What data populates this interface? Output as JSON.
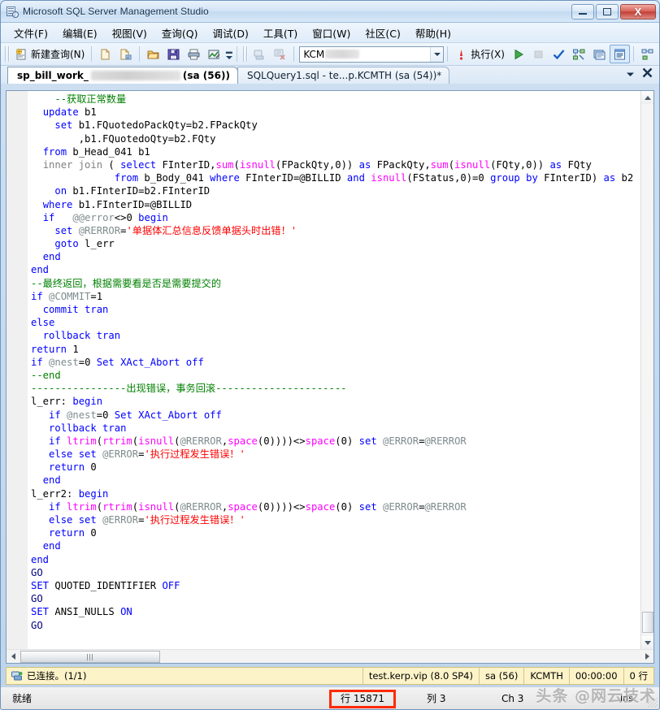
{
  "window": {
    "title": "Microsoft SQL Server Management Studio",
    "app_icon": "ssms-icon",
    "minimize_label": "",
    "maximize_label": "",
    "close_label": "X"
  },
  "menubar": {
    "items": [
      {
        "label": "文件(F)",
        "name": "menu-file"
      },
      {
        "label": "编辑(E)",
        "name": "menu-edit"
      },
      {
        "label": "视图(V)",
        "name": "menu-view"
      },
      {
        "label": "查询(Q)",
        "name": "menu-query"
      },
      {
        "label": "调试(D)",
        "name": "menu-debug"
      },
      {
        "label": "工具(T)",
        "name": "menu-tools"
      },
      {
        "label": "窗口(W)",
        "name": "menu-window"
      },
      {
        "label": "社区(C)",
        "name": "menu-community"
      },
      {
        "label": "帮助(H)",
        "name": "menu-help"
      }
    ]
  },
  "toolbar": {
    "new_query_label": "新建查询(N)",
    "execute_label": "执行(X)",
    "database_combo_value": "KCM",
    "database_combo_redacted": true,
    "icons": [
      "new-query-icon",
      "new-file-icon",
      "new-file-script-icon",
      "open-folder-icon",
      "save-icon",
      "print-icon",
      "analyze-icon",
      "server-icon",
      "server-stop-icon",
      "execute-run-icon",
      "stop-icon",
      "parse-check-icon",
      "display-plan-icon",
      "client-stats-icon",
      "results-grid-icon",
      "results-text-icon",
      "include-plan-icon",
      "results-file-icon"
    ]
  },
  "tabs": {
    "items": [
      {
        "name": "tab-sp-bill-work",
        "prefix": "sp_bill_work_",
        "redacted": true,
        "suffix": "(sa (56))",
        "active": true
      },
      {
        "name": "tab-sqlquery1",
        "prefix": "SQLQuery1.sql - te...p.KCMTH (sa (54))*",
        "redacted": false,
        "suffix": "",
        "active": false
      }
    ],
    "dropdown_icon": "chevron-down-icon",
    "close_icon": "close-icon"
  },
  "editor": {
    "lines": [
      [
        {
          "t": "    ",
          "c": "pl"
        },
        {
          "t": "--获取正常数量",
          "c": "cm"
        }
      ],
      [
        {
          "t": "  ",
          "c": "pl"
        },
        {
          "t": "update",
          "c": "kw"
        },
        {
          "t": " b1",
          "c": "pl"
        }
      ],
      [
        {
          "t": "    ",
          "c": "pl"
        },
        {
          "t": "set",
          "c": "kw"
        },
        {
          "t": " b1.FQuotedoPackQty=b2.FPackQty",
          "c": "pl"
        }
      ],
      [
        {
          "t": "        ,b1.FQuotedoQty=b2.FQty",
          "c": "pl"
        }
      ],
      [
        {
          "t": "  ",
          "c": "pl"
        },
        {
          "t": "from",
          "c": "kw"
        },
        {
          "t": " b_Head_041 b1",
          "c": "pl"
        }
      ],
      [
        {
          "t": "  ",
          "c": "pl"
        },
        {
          "t": "inner join",
          "c": "op"
        },
        {
          "t": " ( ",
          "c": "pl"
        },
        {
          "t": "select",
          "c": "kw"
        },
        {
          "t": " FInterID,",
          "c": "pl"
        },
        {
          "t": "sum",
          "c": "fn"
        },
        {
          "t": "(",
          "c": "pl"
        },
        {
          "t": "isnull",
          "c": "fn"
        },
        {
          "t": "(FPackQty,",
          "c": "pl"
        },
        {
          "t": "0",
          "c": "num"
        },
        {
          "t": ")) ",
          "c": "pl"
        },
        {
          "t": "as",
          "c": "kw"
        },
        {
          "t": " FPackQty,",
          "c": "pl"
        },
        {
          "t": "sum",
          "c": "fn"
        },
        {
          "t": "(",
          "c": "pl"
        },
        {
          "t": "isnull",
          "c": "fn"
        },
        {
          "t": "(FQty,",
          "c": "pl"
        },
        {
          "t": "0",
          "c": "num"
        },
        {
          "t": ")) ",
          "c": "pl"
        },
        {
          "t": "as",
          "c": "kw"
        },
        {
          "t": " FQty",
          "c": "pl"
        }
      ],
      [
        {
          "t": "              ",
          "c": "pl"
        },
        {
          "t": "from",
          "c": "kw"
        },
        {
          "t": " b_Body_041 ",
          "c": "pl"
        },
        {
          "t": "where",
          "c": "kw"
        },
        {
          "t": " FInterID=@BILLID ",
          "c": "pl"
        },
        {
          "t": "and",
          "c": "kw"
        },
        {
          "t": " ",
          "c": "pl"
        },
        {
          "t": "isnull",
          "c": "fn"
        },
        {
          "t": "(FStatus,",
          "c": "pl"
        },
        {
          "t": "0",
          "c": "num"
        },
        {
          "t": ")=",
          "c": "pl"
        },
        {
          "t": "0",
          "c": "num"
        },
        {
          "t": " ",
          "c": "pl"
        },
        {
          "t": "group by",
          "c": "kw"
        },
        {
          "t": " FInterID) ",
          "c": "pl"
        },
        {
          "t": "as",
          "c": "kw"
        },
        {
          "t": " b2",
          "c": "pl"
        }
      ],
      [
        {
          "t": "    ",
          "c": "pl"
        },
        {
          "t": "on",
          "c": "kw"
        },
        {
          "t": " b1.FInterID=b2.FInterID",
          "c": "pl"
        }
      ],
      [
        {
          "t": "  ",
          "c": "pl"
        },
        {
          "t": "where",
          "c": "kw"
        },
        {
          "t": " b1.FInterID=@BILLID",
          "c": "pl"
        }
      ],
      [
        {
          "t": "  ",
          "c": "pl"
        },
        {
          "t": "if",
          "c": "kw"
        },
        {
          "t": "   ",
          "c": "pl"
        },
        {
          "t": "@@error",
          "c": "var"
        },
        {
          "t": "<>",
          "c": "pl"
        },
        {
          "t": "0",
          "c": "num"
        },
        {
          "t": " ",
          "c": "pl"
        },
        {
          "t": "begin",
          "c": "kw"
        }
      ],
      [
        {
          "t": "    ",
          "c": "pl"
        },
        {
          "t": "set",
          "c": "kw"
        },
        {
          "t": " ",
          "c": "pl"
        },
        {
          "t": "@RERROR",
          "c": "var"
        },
        {
          "t": "=",
          "c": "pl"
        },
        {
          "t": "'单据体汇总信息反馈单据头时出错！'",
          "c": "st"
        }
      ],
      [
        {
          "t": "    ",
          "c": "pl"
        },
        {
          "t": "goto",
          "c": "kw"
        },
        {
          "t": " l_err",
          "c": "pl"
        }
      ],
      [
        {
          "t": "  ",
          "c": "pl"
        },
        {
          "t": "end",
          "c": "kw"
        }
      ],
      [
        {
          "t": "",
          "c": "pl"
        },
        {
          "t": "end",
          "c": "kw"
        }
      ],
      [
        {
          "t": "--最终返回，根据需要看是否是需要提交的",
          "c": "cm"
        }
      ],
      [
        {
          "t": "",
          "c": "pl"
        },
        {
          "t": "if",
          "c": "kw"
        },
        {
          "t": " ",
          "c": "pl"
        },
        {
          "t": "@COMMIT",
          "c": "var"
        },
        {
          "t": "=",
          "c": "pl"
        },
        {
          "t": "1",
          "c": "num"
        }
      ],
      [
        {
          "t": "  ",
          "c": "pl"
        },
        {
          "t": "commit tran",
          "c": "kw"
        }
      ],
      [
        {
          "t": "",
          "c": "pl"
        },
        {
          "t": "else",
          "c": "kw"
        }
      ],
      [
        {
          "t": "  ",
          "c": "pl"
        },
        {
          "t": "rollback tran",
          "c": "kw"
        }
      ],
      [
        {
          "t": "",
          "c": "pl"
        },
        {
          "t": "return",
          "c": "kw"
        },
        {
          "t": " ",
          "c": "pl"
        },
        {
          "t": "1",
          "c": "num"
        }
      ],
      [
        {
          "t": "",
          "c": "pl"
        },
        {
          "t": "if",
          "c": "kw"
        },
        {
          "t": " ",
          "c": "pl"
        },
        {
          "t": "@nest",
          "c": "var"
        },
        {
          "t": "=",
          "c": "pl"
        },
        {
          "t": "0",
          "c": "num"
        },
        {
          "t": " ",
          "c": "pl"
        },
        {
          "t": "Set XAct_Abort off",
          "c": "kw"
        }
      ],
      [
        {
          "t": "--end",
          "c": "cm"
        }
      ],
      [
        {
          "t": "----------------出现错误，事务回滚----------------------",
          "c": "cm"
        }
      ],
      [
        {
          "t": "",
          "c": "pl"
        },
        {
          "t": "l_err: ",
          "c": "pl"
        },
        {
          "t": "begin",
          "c": "kw"
        }
      ],
      [
        {
          "t": "   ",
          "c": "pl"
        },
        {
          "t": "if",
          "c": "kw"
        },
        {
          "t": " ",
          "c": "pl"
        },
        {
          "t": "@nest",
          "c": "var"
        },
        {
          "t": "=",
          "c": "pl"
        },
        {
          "t": "0",
          "c": "num"
        },
        {
          "t": " ",
          "c": "pl"
        },
        {
          "t": "Set XAct_Abort off",
          "c": "kw"
        }
      ],
      [
        {
          "t": "   ",
          "c": "pl"
        },
        {
          "t": "rollback tran",
          "c": "kw"
        }
      ],
      [
        {
          "t": "   ",
          "c": "pl"
        },
        {
          "t": "if",
          "c": "kw"
        },
        {
          "t": " ",
          "c": "pl"
        },
        {
          "t": "ltrim",
          "c": "fn"
        },
        {
          "t": "(",
          "c": "pl"
        },
        {
          "t": "rtrim",
          "c": "fn"
        },
        {
          "t": "(",
          "c": "pl"
        },
        {
          "t": "isnull",
          "c": "fn"
        },
        {
          "t": "(",
          "c": "pl"
        },
        {
          "t": "@RERROR",
          "c": "var"
        },
        {
          "t": ",",
          "c": "pl"
        },
        {
          "t": "space",
          "c": "fn"
        },
        {
          "t": "(",
          "c": "pl"
        },
        {
          "t": "0",
          "c": "num"
        },
        {
          "t": "))))<>",
          "c": "pl"
        },
        {
          "t": "space",
          "c": "fn"
        },
        {
          "t": "(",
          "c": "pl"
        },
        {
          "t": "0",
          "c": "num"
        },
        {
          "t": ") ",
          "c": "pl"
        },
        {
          "t": "set",
          "c": "kw"
        },
        {
          "t": " ",
          "c": "pl"
        },
        {
          "t": "@ERROR",
          "c": "var"
        },
        {
          "t": "=",
          "c": "pl"
        },
        {
          "t": "@RERROR",
          "c": "var"
        }
      ],
      [
        {
          "t": "   ",
          "c": "pl"
        },
        {
          "t": "else",
          "c": "kw"
        },
        {
          "t": " ",
          "c": "pl"
        },
        {
          "t": "set",
          "c": "kw"
        },
        {
          "t": " ",
          "c": "pl"
        },
        {
          "t": "@ERROR",
          "c": "var"
        },
        {
          "t": "=",
          "c": "pl"
        },
        {
          "t": "'执行过程发生错误！'",
          "c": "st"
        }
      ],
      [
        {
          "t": "   ",
          "c": "pl"
        },
        {
          "t": "return",
          "c": "kw"
        },
        {
          "t": " ",
          "c": "pl"
        },
        {
          "t": "0",
          "c": "num"
        }
      ],
      [
        {
          "t": "  ",
          "c": "pl"
        },
        {
          "t": "end",
          "c": "kw"
        }
      ],
      [
        {
          "t": "",
          "c": "pl"
        },
        {
          "t": "l_err2: ",
          "c": "pl"
        },
        {
          "t": "begin",
          "c": "kw"
        }
      ],
      [
        {
          "t": "   ",
          "c": "pl"
        },
        {
          "t": "if",
          "c": "kw"
        },
        {
          "t": " ",
          "c": "pl"
        },
        {
          "t": "ltrim",
          "c": "fn"
        },
        {
          "t": "(",
          "c": "pl"
        },
        {
          "t": "rtrim",
          "c": "fn"
        },
        {
          "t": "(",
          "c": "pl"
        },
        {
          "t": "isnull",
          "c": "fn"
        },
        {
          "t": "(",
          "c": "pl"
        },
        {
          "t": "@RERROR",
          "c": "var"
        },
        {
          "t": ",",
          "c": "pl"
        },
        {
          "t": "space",
          "c": "fn"
        },
        {
          "t": "(",
          "c": "pl"
        },
        {
          "t": "0",
          "c": "num"
        },
        {
          "t": "))))<>",
          "c": "pl"
        },
        {
          "t": "space",
          "c": "fn"
        },
        {
          "t": "(",
          "c": "pl"
        },
        {
          "t": "0",
          "c": "num"
        },
        {
          "t": ") ",
          "c": "pl"
        },
        {
          "t": "set",
          "c": "kw"
        },
        {
          "t": " ",
          "c": "pl"
        },
        {
          "t": "@ERROR",
          "c": "var"
        },
        {
          "t": "=",
          "c": "pl"
        },
        {
          "t": "@RERROR",
          "c": "var"
        }
      ],
      [
        {
          "t": "   ",
          "c": "pl"
        },
        {
          "t": "else",
          "c": "kw"
        },
        {
          "t": " ",
          "c": "pl"
        },
        {
          "t": "set",
          "c": "kw"
        },
        {
          "t": " ",
          "c": "pl"
        },
        {
          "t": "@ERROR",
          "c": "var"
        },
        {
          "t": "=",
          "c": "pl"
        },
        {
          "t": "'执行过程发生错误！'",
          "c": "st"
        }
      ],
      [
        {
          "t": "   ",
          "c": "pl"
        },
        {
          "t": "return",
          "c": "kw"
        },
        {
          "t": " ",
          "c": "pl"
        },
        {
          "t": "0",
          "c": "num"
        }
      ],
      [
        {
          "t": "  ",
          "c": "pl"
        },
        {
          "t": "end",
          "c": "kw"
        }
      ],
      [
        {
          "t": "",
          "c": "pl"
        },
        {
          "t": "end",
          "c": "kw"
        }
      ],
      [
        {
          "t": "",
          "c": "pl"
        },
        {
          "t": "GO",
          "c": "kw2"
        }
      ],
      [
        {
          "t": "",
          "c": "pl"
        },
        {
          "t": "SET",
          "c": "kw"
        },
        {
          "t": " QUOTED_IDENTIFIER ",
          "c": "pl"
        },
        {
          "t": "OFF",
          "c": "kw"
        }
      ],
      [
        {
          "t": "",
          "c": "pl"
        },
        {
          "t": "GO",
          "c": "kw2"
        }
      ],
      [
        {
          "t": "",
          "c": "pl"
        },
        {
          "t": "SET",
          "c": "kw"
        },
        {
          "t": " ANSI_NULLS ",
          "c": "pl"
        },
        {
          "t": "ON",
          "c": "kw"
        }
      ],
      [
        {
          "t": "",
          "c": "pl"
        },
        {
          "t": "GO",
          "c": "kw2"
        }
      ]
    ]
  },
  "connection_bar": {
    "icon": "connected-server-icon",
    "status": "已连接。(1/1)",
    "server": "test.kerp.vip (8.0 SP4)",
    "login": "sa (56)",
    "database": "KCMTH",
    "elapsed": "00:00:00",
    "rows": "0 行"
  },
  "statusbar": {
    "ready": "就绪",
    "line": "行 15871",
    "column": "列 3",
    "char": "Ch 3",
    "insert_mode": "Ins",
    "watermark": "头条 @网云技术",
    "highlight_color": "#ff2a00"
  }
}
